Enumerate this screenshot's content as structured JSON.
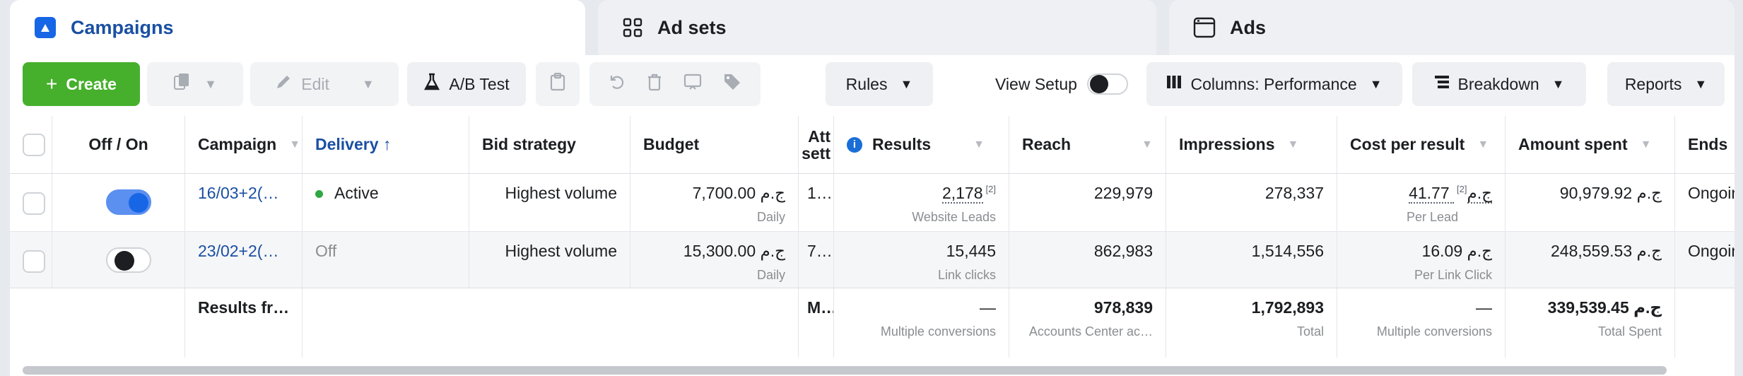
{
  "tabs": {
    "campaigns": "Campaigns",
    "adsets": "Ad sets",
    "ads": "Ads"
  },
  "toolbar": {
    "create": "Create",
    "edit": "Edit",
    "ab_test": "A/B Test",
    "rules": "Rules",
    "view_setup": "View Setup",
    "columns": "Columns: Performance",
    "breakdown": "Breakdown",
    "reports": "Reports"
  },
  "table": {
    "headers": {
      "toggle": "Off / On",
      "campaign": "Campaign",
      "delivery": "Delivery ↑",
      "bid": "Bid strategy",
      "budget": "Budget",
      "attr_line1": "Att",
      "attr_line2": "sett",
      "results": "Results",
      "reach": "Reach",
      "impressions": "Impressions",
      "cost_per_result": "Cost per result",
      "amount_spent": "Amount spent",
      "ends": "Ends"
    },
    "rows": [
      {
        "status": "on",
        "name": "16/03+2(…",
        "delivery": "Active",
        "bid": "Highest volume",
        "budget": "7,700.00 ج.م",
        "budget_sub": "Daily",
        "attr": "1…",
        "results": "2,178",
        "results_sup": "[2]",
        "results_sub": "Website Leads",
        "reach": "229,979",
        "impressions": "278,337",
        "cpr": "41.77 ج.م",
        "cpr_sup": "[2]",
        "cpr_sub": "Per Lead",
        "spent": "90,979.92 ج.م",
        "ends": "Ongoing"
      },
      {
        "status": "off",
        "name": "23/02+2(…",
        "delivery": "Off",
        "bid": "Highest volume",
        "budget": "15,300.00 ج.م",
        "budget_sub": "Daily",
        "attr": "7…",
        "results": "15,445",
        "results_sub": "Link clicks",
        "reach": "862,983",
        "impressions": "1,514,556",
        "cpr": "16.09 ج.م",
        "cpr_sub": "Per Link Click",
        "spent": "248,559.53 ج.م",
        "ends": "Ongoing"
      }
    ],
    "totals": {
      "label": "Results fr…",
      "attr": "M…",
      "results": "—",
      "results_sub": "Multiple conversions",
      "reach": "978,839",
      "reach_sub": "Accounts Center ac…",
      "impressions": "1,792,893",
      "impressions_sub": "Total",
      "cpr": "—",
      "cpr_sub": "Multiple conversions",
      "spent": "339,539.45 ج.م",
      "spent_sub": "Total Spent"
    }
  },
  "colors": {
    "accent": "#1a4fa3",
    "create": "#46b02c",
    "active_dot": "#2ea842",
    "toggle_on": "#1766e5"
  }
}
